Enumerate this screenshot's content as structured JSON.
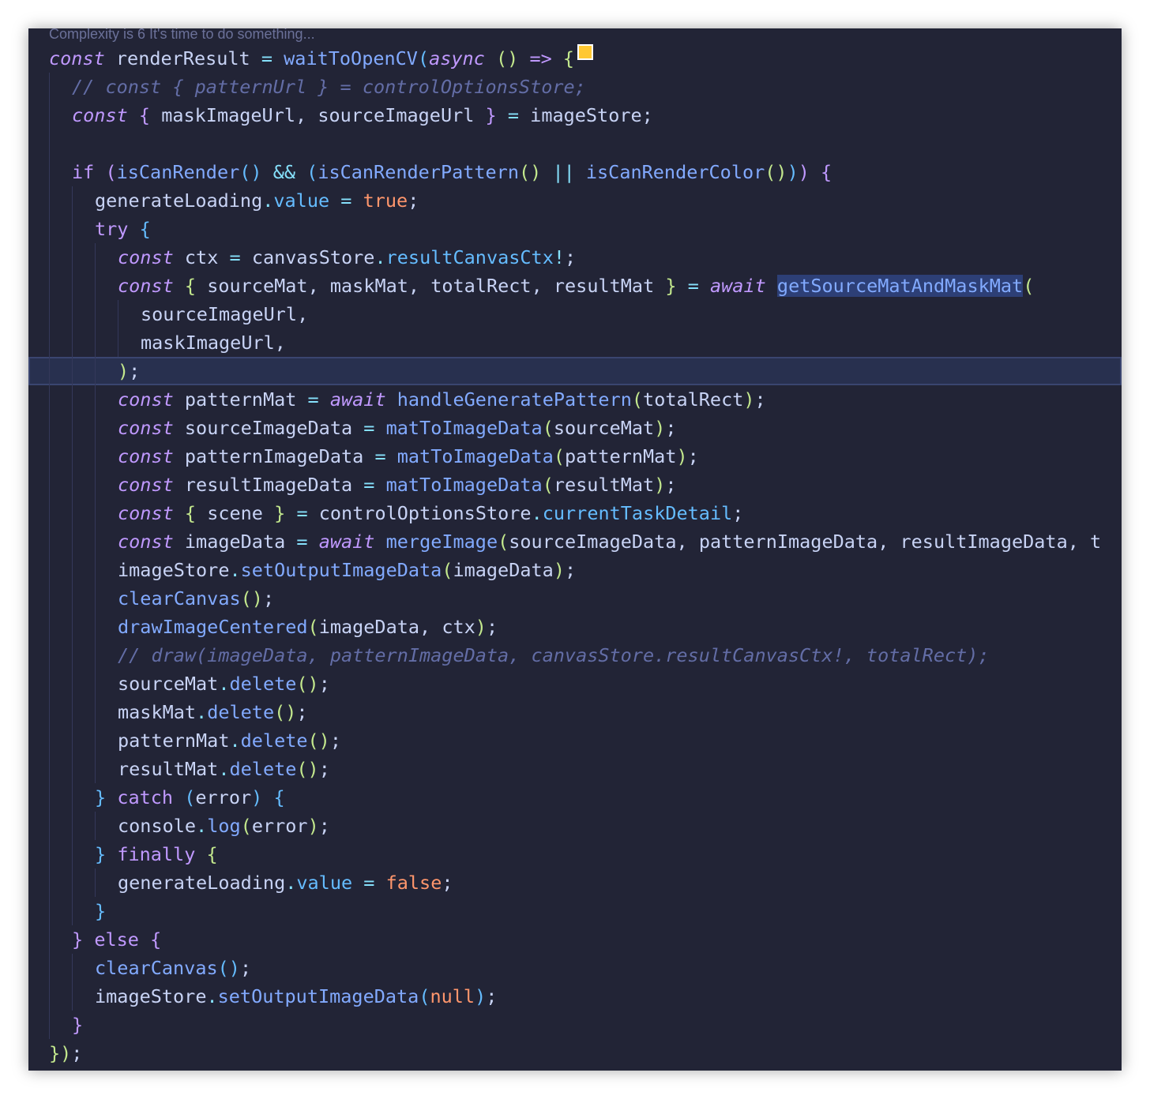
{
  "codelens": "Complexity is 6 It's time to do something...",
  "colors": {
    "background": "#222436",
    "current_line": "#28304f",
    "keyword": "#c099ff",
    "function": "#82aaff",
    "property": "#65bcff",
    "boolean": "#ff966c",
    "comment": "#636da6",
    "swatch": "#ffc832"
  },
  "code": {
    "l1": {
      "const": "const",
      "name": "renderResult",
      "eq": "=",
      "fn": "waitToOpenCV",
      "paren": "(",
      "async": "async",
      "params": "()",
      "arrow": "=>",
      "brace": "{"
    },
    "l2": {
      "comment": "// const { patternUrl } = controlOptionsStore;"
    },
    "l3": {
      "const": "const",
      "open": "{",
      "a": "maskImageUrl",
      "comma": ",",
      "b": "sourceImageUrl",
      "close": "}",
      "eq": "=",
      "store": "imageStore",
      "semi": ";"
    },
    "l5": {
      "if": "if",
      "p1": "(",
      "f1": "isCanRender",
      "c1": "()",
      "and": "&&",
      "p2": "(",
      "f2": "isCanRenderPattern",
      "c2": "()",
      "or": "||",
      "f3": "isCanRenderColor",
      "c3": "()",
      "close2": ")",
      "close1": ")",
      "brace": "{"
    },
    "l6": {
      "obj": "generateLoading",
      "dot": ".",
      "prop": "value",
      "eq": "=",
      "val": "true",
      "semi": ";"
    },
    "l7": {
      "try": "try",
      "brace": "{"
    },
    "l8": {
      "const": "const",
      "name": "ctx",
      "eq": "=",
      "obj": "canvasStore",
      "dot": ".",
      "prop": "resultCanvasCtx",
      "bang": "!",
      "semi": ";"
    },
    "l9": {
      "const": "const",
      "open": "{",
      "a": "sourceMat",
      "b": "maskMat",
      "c": "totalRect",
      "d": "resultMat",
      "comma": ",",
      "close": "}",
      "eq": "=",
      "await": "await",
      "fn": "getSourceMatAndMaskMat",
      "paren": "("
    },
    "l10": {
      "arg": "sourceImageUrl",
      "comma": ","
    },
    "l11": {
      "arg": "maskImageUrl",
      "comma": ","
    },
    "l12": {
      "paren": ")",
      "semi": ";"
    },
    "l13": {
      "const": "const",
      "name": "patternMat",
      "eq": "=",
      "await": "await",
      "fn": "handleGeneratePattern",
      "open": "(",
      "arg": "totalRect",
      "close": ")",
      "semi": ";"
    },
    "l14": {
      "const": "const",
      "name": "sourceImageData",
      "eq": "=",
      "fn": "matToImageData",
      "open": "(",
      "arg": "sourceMat",
      "close": ")",
      "semi": ";"
    },
    "l15": {
      "const": "const",
      "name": "patternImageData",
      "eq": "=",
      "fn": "matToImageData",
      "open": "(",
      "arg": "patternMat",
      "close": ")",
      "semi": ";"
    },
    "l16": {
      "const": "const",
      "name": "resultImageData",
      "eq": "=",
      "fn": "matToImageData",
      "open": "(",
      "arg": "resultMat",
      "close": ")",
      "semi": ";"
    },
    "l17": {
      "const": "const",
      "open": "{",
      "name": "scene",
      "close": "}",
      "eq": "=",
      "obj": "controlOptionsStore",
      "dot": ".",
      "prop": "currentTaskDetail",
      "semi": ";"
    },
    "l18": {
      "const": "const",
      "name": "imageData",
      "eq": "=",
      "await": "await",
      "fn": "mergeImage",
      "open": "(",
      "a": "sourceImageData",
      "b": "patternImageData",
      "c": "resultImageData",
      "comma": ",",
      "d": "t"
    },
    "l19": {
      "obj": "imageStore",
      "dot": ".",
      "fn": "setOutputImageData",
      "open": "(",
      "arg": "imageData",
      "close": ")",
      "semi": ";"
    },
    "l20": {
      "fn": "clearCanvas",
      "call": "()",
      "semi": ";"
    },
    "l21": {
      "fn": "drawImageCentered",
      "open": "(",
      "a": "imageData",
      "comma": ",",
      "b": "ctx",
      "close": ")",
      "semi": ";"
    },
    "l22": {
      "comment": "// draw(imageData, patternImageData, canvasStore.resultCanvasCtx!, totalRect);"
    },
    "l23": {
      "obj": "sourceMat",
      "dot": ".",
      "fn": "delete",
      "call": "()",
      "semi": ";"
    },
    "l24": {
      "obj": "maskMat",
      "dot": ".",
      "fn": "delete",
      "call": "()",
      "semi": ";"
    },
    "l25": {
      "obj": "patternMat",
      "dot": ".",
      "fn": "delete",
      "call": "()",
      "semi": ";"
    },
    "l26": {
      "obj": "resultMat",
      "dot": ".",
      "fn": "delete",
      "call": "()",
      "semi": ";"
    },
    "l27": {
      "close": "}",
      "catch": "catch",
      "open": "(",
      "arg": "error",
      "cparen": ")",
      "brace": "{"
    },
    "l28": {
      "obj": "console",
      "dot": ".",
      "fn": "log",
      "open": "(",
      "arg": "error",
      "close": ")",
      "semi": ";"
    },
    "l29": {
      "close": "}",
      "finally": "finally",
      "brace": "{"
    },
    "l30": {
      "obj": "generateLoading",
      "dot": ".",
      "prop": "value",
      "eq": "=",
      "val": "false",
      "semi": ";"
    },
    "l31": {
      "close": "}"
    },
    "l32": {
      "close": "}",
      "else": "else",
      "brace": "{"
    },
    "l33": {
      "fn": "clearCanvas",
      "call": "()",
      "semi": ";"
    },
    "l34": {
      "obj": "imageStore",
      "dot": ".",
      "fn": "setOutputImageData",
      "open": "(",
      "arg": "null",
      "close": ")",
      "semi": ";"
    },
    "l35": {
      "close": "}"
    },
    "l36": {
      "close": "})",
      "semi": ";"
    }
  }
}
